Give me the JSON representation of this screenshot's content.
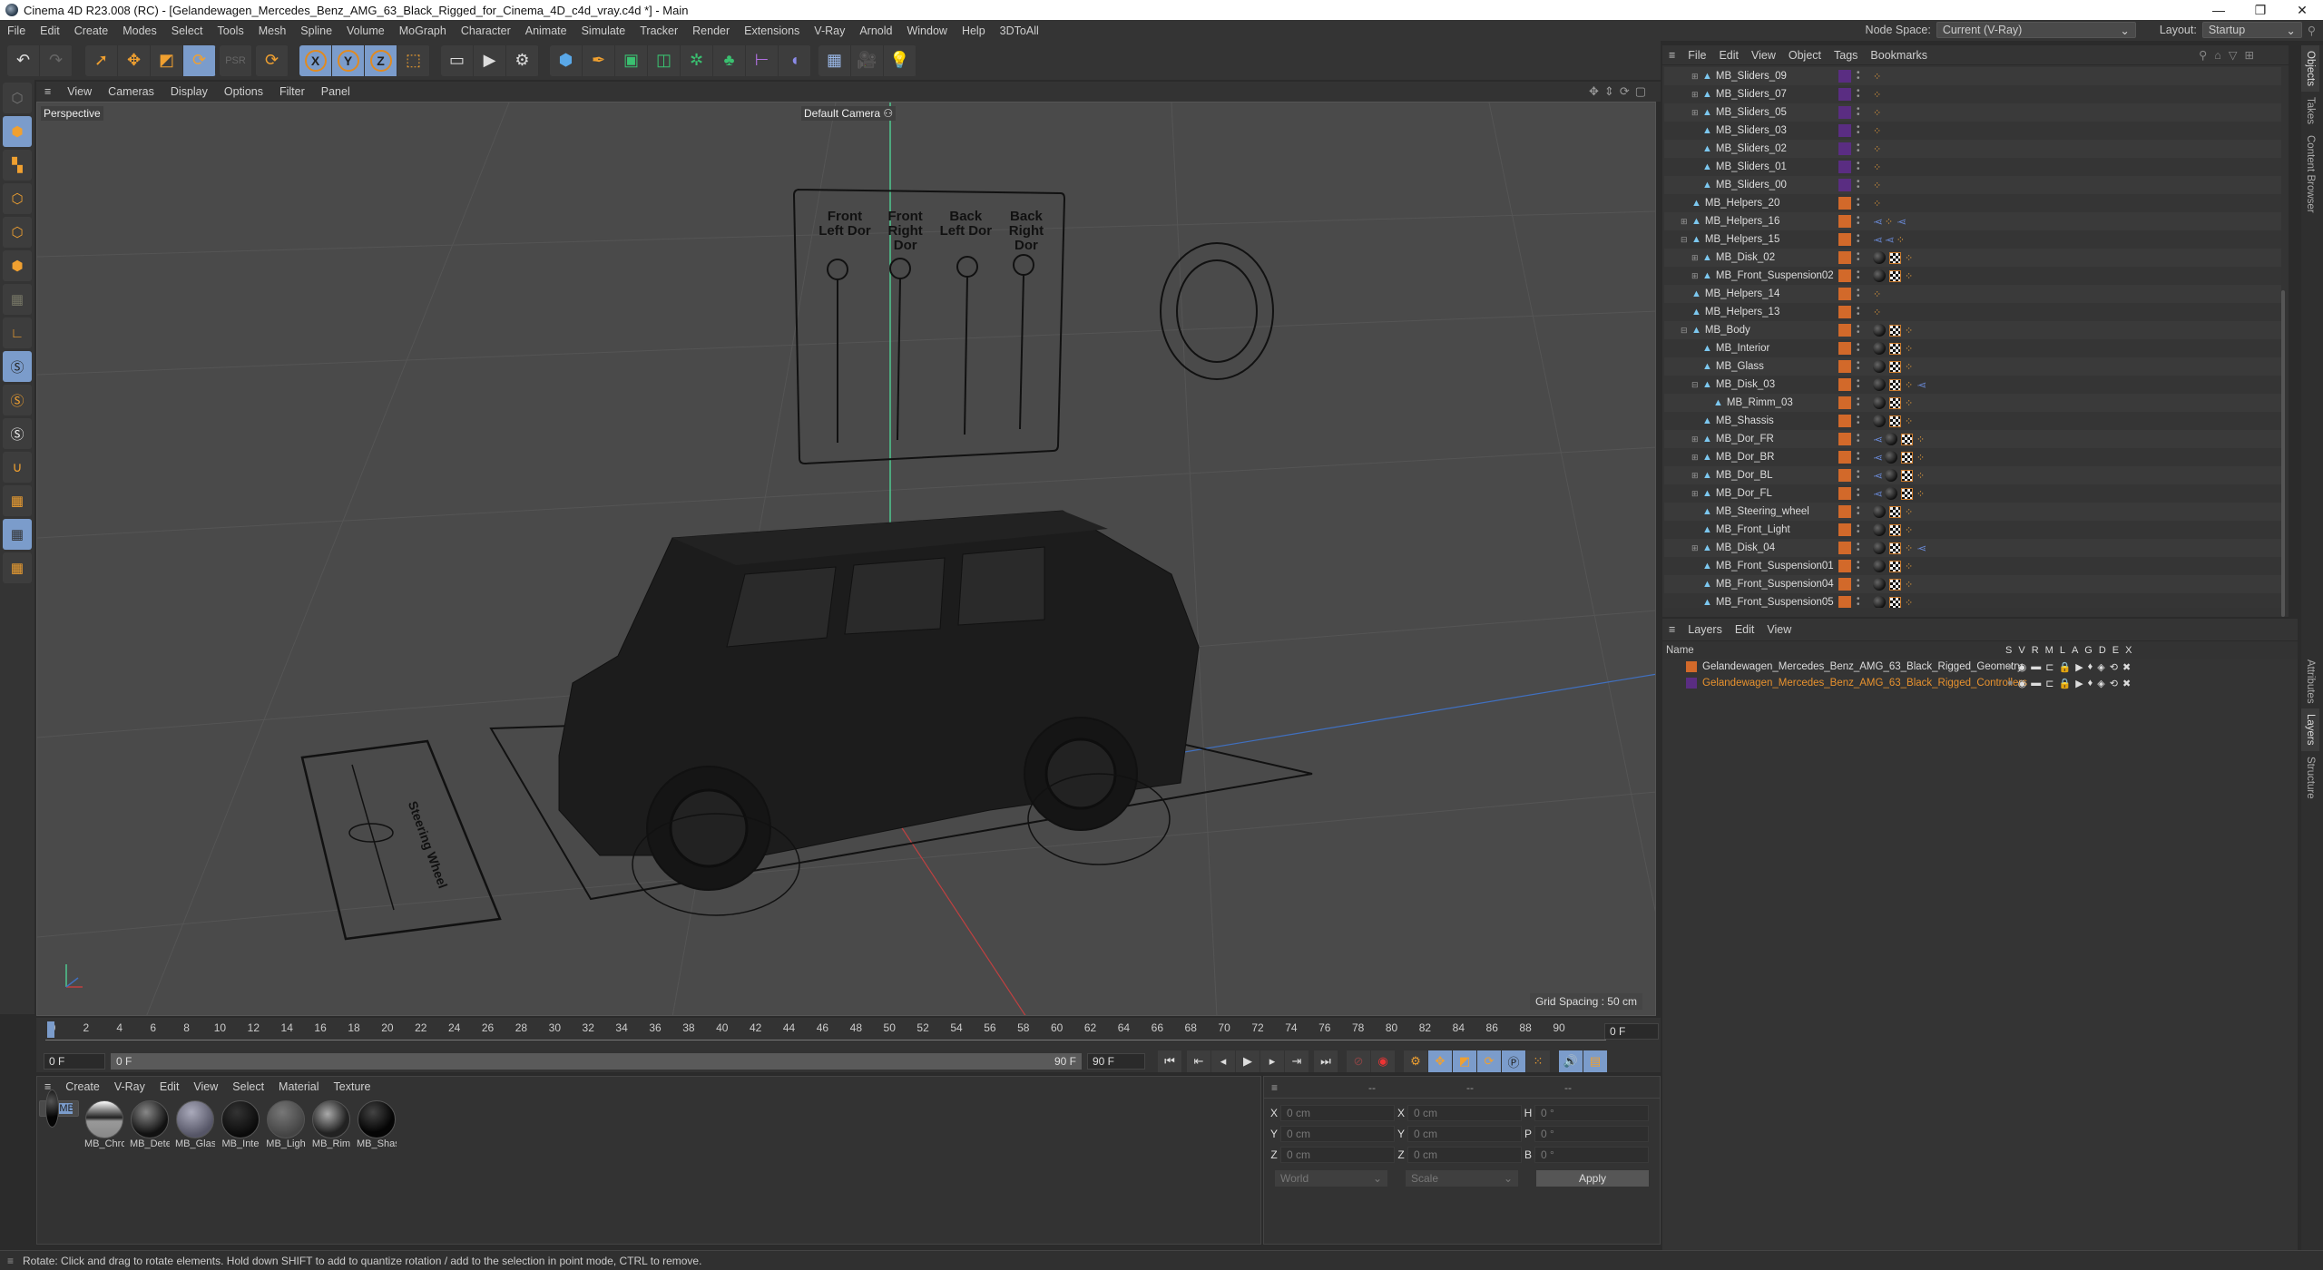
{
  "window": {
    "title": "Cinema 4D R23.008 (RC) - [Gelandewagen_Mercedes_Benz_AMG_63_Black_Rigged_for_Cinema_4D_c4d_vray.c4d *] - Main",
    "controls": {
      "minimize": "—",
      "maximize": "❐",
      "close": "✕"
    }
  },
  "menubar": {
    "items": [
      "File",
      "Edit",
      "Create",
      "Modes",
      "Select",
      "Tools",
      "Mesh",
      "Spline",
      "Volume",
      "MoGraph",
      "Character",
      "Animate",
      "Simulate",
      "Tracker",
      "Render",
      "Extensions",
      "V-Ray",
      "Arnold",
      "Window",
      "Help",
      "3DToAll"
    ],
    "node_space_label": "Node Space:",
    "node_space_value": "Current (V-Ray)",
    "layout_label": "Layout:",
    "layout_value": "Startup"
  },
  "toolbar": {
    "undo": "undo-icon",
    "redo": "redo-icon",
    "tools": [
      "select",
      "move",
      "scale",
      "rotate",
      "psr",
      "recent"
    ],
    "axes": [
      "X",
      "Y",
      "Z"
    ]
  },
  "viewport": {
    "menu": [
      "View",
      "Cameras",
      "Display",
      "Options",
      "Filter",
      "Panel"
    ],
    "label": "Perspective",
    "camera": "Default Camera",
    "grid_spacing": "Grid Spacing : 50 cm",
    "door_labels": [
      "Front Left Dor",
      "Front Right Dor",
      "Back Left Dor",
      "Back Right Dor"
    ],
    "steering_label": "Steering Wheel"
  },
  "timeline": {
    "ticks": [
      "0",
      "2",
      "4",
      "6",
      "8",
      "10",
      "12",
      "14",
      "16",
      "18",
      "20",
      "22",
      "24",
      "26",
      "28",
      "30",
      "32",
      "34",
      "36",
      "38",
      "40",
      "42",
      "44",
      "46",
      "48",
      "50",
      "52",
      "54",
      "56",
      "58",
      "60",
      "62",
      "64",
      "66",
      "68",
      "70",
      "72",
      "74",
      "76",
      "78",
      "80",
      "82",
      "84",
      "86",
      "88",
      "90"
    ],
    "current_frame": "0 F",
    "start_field": "0 F",
    "range_start": "0 F",
    "range_end": "90 F",
    "end_field": "90 F"
  },
  "materials": {
    "menu": [
      "Create",
      "V-Ray",
      "Edit",
      "View",
      "Select",
      "Material",
      "Texture"
    ],
    "items": [
      {
        "name": "MB_Body",
        "selected": true
      },
      {
        "name": "MB_Chro"
      },
      {
        "name": "MB_Dete"
      },
      {
        "name": "MB_Glas"
      },
      {
        "name": "MB_Inte"
      },
      {
        "name": "MB_Ligh"
      },
      {
        "name": "MB_Rim"
      },
      {
        "name": "MB_Shas"
      }
    ]
  },
  "coordinates": {
    "headers": [
      "--",
      "--",
      "--"
    ],
    "rows": [
      {
        "l1": "X",
        "v1": "0 cm",
        "l2": "X",
        "v2": "0 cm",
        "l3": "H",
        "v3": "0 °"
      },
      {
        "l1": "Y",
        "v1": "0 cm",
        "l2": "Y",
        "v2": "0 cm",
        "l3": "P",
        "v3": "0 °"
      },
      {
        "l1": "Z",
        "v1": "0 cm",
        "l2": "Z",
        "v2": "0 cm",
        "l3": "B",
        "v3": "0 °"
      }
    ],
    "mode": "World",
    "scale_mode": "Scale",
    "apply": "Apply"
  },
  "objects": {
    "menu": [
      "File",
      "Edit",
      "View",
      "Object",
      "Tags",
      "Bookmarks"
    ],
    "rows": [
      {
        "name": "MB_Sliders_09",
        "indent": 2,
        "exp": "+",
        "color": "#5a2d82",
        "tags": "x"
      },
      {
        "name": "MB_Sliders_07",
        "indent": 2,
        "exp": "+",
        "color": "#5a2d82",
        "tags": "x"
      },
      {
        "name": "MB_Sliders_05",
        "indent": 2,
        "exp": "+",
        "color": "#5a2d82",
        "tags": "x"
      },
      {
        "name": "MB_Sliders_03",
        "indent": 2,
        "exp": "",
        "color": "#5a2d82",
        "tags": "x"
      },
      {
        "name": "MB_Sliders_02",
        "indent": 2,
        "exp": "",
        "color": "#5a2d82",
        "tags": "x"
      },
      {
        "name": "MB_Sliders_01",
        "indent": 2,
        "exp": "",
        "color": "#5a2d82",
        "tags": "x"
      },
      {
        "name": "MB_Sliders_00",
        "indent": 2,
        "exp": "",
        "color": "#5a2d82",
        "tags": "x"
      },
      {
        "name": "MB_Helpers_20",
        "indent": 1,
        "exp": "",
        "color": "#d2692a",
        "tags": "x"
      },
      {
        "name": "MB_Helpers_16",
        "indent": 1,
        "exp": "+",
        "color": "#d2692a",
        "tags": "vxv"
      },
      {
        "name": "MB_Helpers_15",
        "indent": 1,
        "exp": "-",
        "color": "#d2692a",
        "tags": "vvx"
      },
      {
        "name": "MB_Disk_02",
        "indent": 2,
        "exp": "+",
        "color": "#d2692a",
        "tags": "mtx"
      },
      {
        "name": "MB_Front_Suspension02",
        "indent": 2,
        "exp": "+",
        "color": "#d2692a",
        "tags": "mtx"
      },
      {
        "name": "MB_Helpers_14",
        "indent": 1,
        "exp": "",
        "color": "#d2692a",
        "tags": "x"
      },
      {
        "name": "MB_Helpers_13",
        "indent": 1,
        "exp": "",
        "color": "#d2692a",
        "tags": "x"
      },
      {
        "name": "MB_Body",
        "indent": 1,
        "exp": "-",
        "color": "#d2692a",
        "tags": "mtx"
      },
      {
        "name": "MB_Interior",
        "indent": 2,
        "exp": "",
        "color": "#d2692a",
        "tags": "mtx"
      },
      {
        "name": "MB_Glass",
        "indent": 2,
        "exp": "",
        "color": "#d2692a",
        "tags": "mtx"
      },
      {
        "name": "MB_Disk_03",
        "indent": 2,
        "exp": "-",
        "color": "#d2692a",
        "tags": "mtxv"
      },
      {
        "name": "MB_Rimm_03",
        "indent": 3,
        "exp": "",
        "color": "#d2692a",
        "tags": "mtx"
      },
      {
        "name": "MB_Shassis",
        "indent": 2,
        "exp": "",
        "color": "#d2692a",
        "tags": "mtx"
      },
      {
        "name": "MB_Dor_FR",
        "indent": 2,
        "exp": "+",
        "color": "#d2692a",
        "tags": "vmtx"
      },
      {
        "name": "MB_Dor_BR",
        "indent": 2,
        "exp": "+",
        "color": "#d2692a",
        "tags": "vmtx"
      },
      {
        "name": "MB_Dor_BL",
        "indent": 2,
        "exp": "+",
        "color": "#d2692a",
        "tags": "vmtx"
      },
      {
        "name": "MB_Dor_FL",
        "indent": 2,
        "exp": "+",
        "color": "#d2692a",
        "tags": "vmtx"
      },
      {
        "name": "MB_Steering_wheel",
        "indent": 2,
        "exp": "",
        "color": "#d2692a",
        "tags": "mtx"
      },
      {
        "name": "MB_Front_Light",
        "indent": 2,
        "exp": "",
        "color": "#d2692a",
        "tags": "mtx"
      },
      {
        "name": "MB_Disk_04",
        "indent": 2,
        "exp": "+",
        "color": "#d2692a",
        "tags": "mtxv"
      },
      {
        "name": "MB_Front_Suspension01",
        "indent": 2,
        "exp": "",
        "color": "#d2692a",
        "tags": "mtx"
      },
      {
        "name": "MB_Front_Suspension04",
        "indent": 2,
        "exp": "",
        "color": "#d2692a",
        "tags": "mtx"
      },
      {
        "name": "MB_Front_Suspension05",
        "indent": 2,
        "exp": "",
        "color": "#d2692a",
        "tags": "mtx"
      }
    ]
  },
  "layers": {
    "menu": [
      "Layers",
      "Edit",
      "View"
    ],
    "name_header": "Name",
    "flag_headers": [
      "S",
      "V",
      "R",
      "M",
      "L",
      "A",
      "G",
      "D",
      "E",
      "X"
    ],
    "rows": [
      {
        "name": "Gelandewagen_Mercedes_Benz_AMG_63_Black_Rigged_Geometry",
        "color": "#d2692a",
        "text_color": "#dddddd"
      },
      {
        "name": "Gelandewagen_Mercedes_Benz_AMG_63_Black_Rigged_Controllers",
        "color": "#5a2d82",
        "text_color": "#e8922e"
      }
    ]
  },
  "side_tabs": {
    "top": [
      "Objects",
      "Takes",
      "Content Browser"
    ],
    "bottom": [
      "Attributes",
      "Layers",
      "Structure"
    ]
  },
  "status": {
    "text": "Rotate: Click and drag to rotate elements. Hold down SHIFT to add to quantize rotation / add to the selection in point mode, CTRL to remove."
  },
  "colors": {
    "accent_blue": "#7b9ccb",
    "orange": "#f0a030",
    "layer_geometry": "#d2692a",
    "layer_controllers": "#5a2d82"
  }
}
